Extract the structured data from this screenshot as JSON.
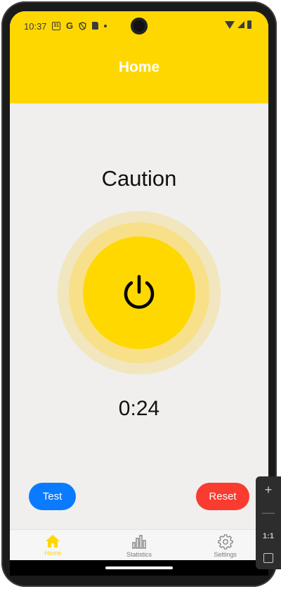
{
  "status_bar": {
    "time": "10:37",
    "calendar_day": "31",
    "g_letter": "G"
  },
  "header": {
    "title": "Home",
    "background_color": "#ffd700"
  },
  "main": {
    "status_text": "Caution",
    "timer": "0:24",
    "power_button_icon": "power-icon",
    "accent_color": "#ffd800"
  },
  "actions": {
    "test_label": "Test",
    "reset_label": "Reset",
    "test_color": "#0a7bff",
    "reset_color": "#fa3b30"
  },
  "bottom_nav": {
    "items": [
      {
        "label": "Home",
        "icon": "home-icon",
        "active": true
      },
      {
        "label": "Statistics",
        "icon": "bar-chart-icon",
        "active": false
      },
      {
        "label": "Settings",
        "icon": "gear-icon",
        "active": false
      }
    ]
  },
  "emulator_toolbar": {
    "zoom_in": "+",
    "zoom_out": "—",
    "ratio": "1:1",
    "fit": "fit-screen-icon"
  }
}
